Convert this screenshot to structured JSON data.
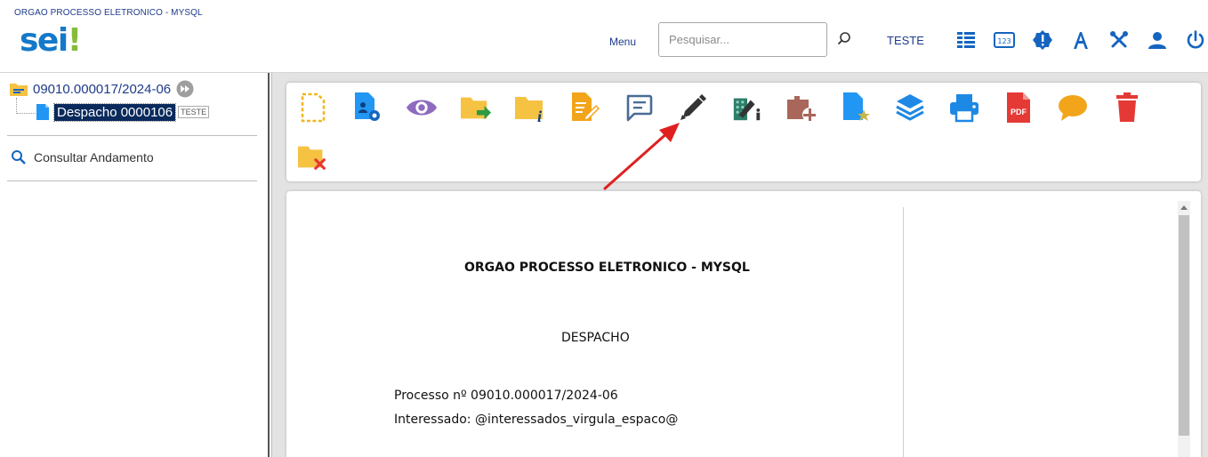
{
  "header": {
    "org_name": "ORGAO PROCESSO ELETRONICO - MYSQL",
    "logo": {
      "text": "sei",
      "mark": "!"
    },
    "menu_label": "Menu",
    "search": {
      "placeholder": "Pesquisar...",
      "value": ""
    },
    "unit_label": "TESTE",
    "icons": [
      "list-icon",
      "numeric-icon",
      "alert-badge-icon",
      "font-icon",
      "tools-icon",
      "user-icon",
      "power-icon"
    ]
  },
  "tree": {
    "process_number": "09010.000017/2024-06",
    "document_label": "Despacho 0000106",
    "document_tag": "TESTE",
    "consult_label": "Consultar Andamento"
  },
  "toolbar": {
    "icons": [
      "new-document-icon",
      "document-settings-icon",
      "view-icon",
      "send-process-icon",
      "process-info-icon",
      "edit-document-icon",
      "comment-icon",
      "sign-document-icon",
      "sign-block-icon",
      "block-add-icon",
      "favorite-document-icon",
      "layers-icon",
      "print-icon",
      "pdf-icon",
      "note-icon",
      "delete-icon",
      "cancel-process-icon"
    ],
    "pdf_text": "PDF"
  },
  "document": {
    "header": "ORGAO PROCESSO ELETRONICO - MYSQL",
    "title": "DESPACHO",
    "process_line": "Processo nº 09010.000017/2024-06",
    "interested_line": "Interessado: @interessados_virgula_espaco@"
  },
  "colors": {
    "brand_blue": "#1479c9",
    "brand_green": "#84bd3a",
    "header_text": "#1f3b8a",
    "folder_yellow": "#f5c242",
    "annotation_red": "#e02020"
  }
}
